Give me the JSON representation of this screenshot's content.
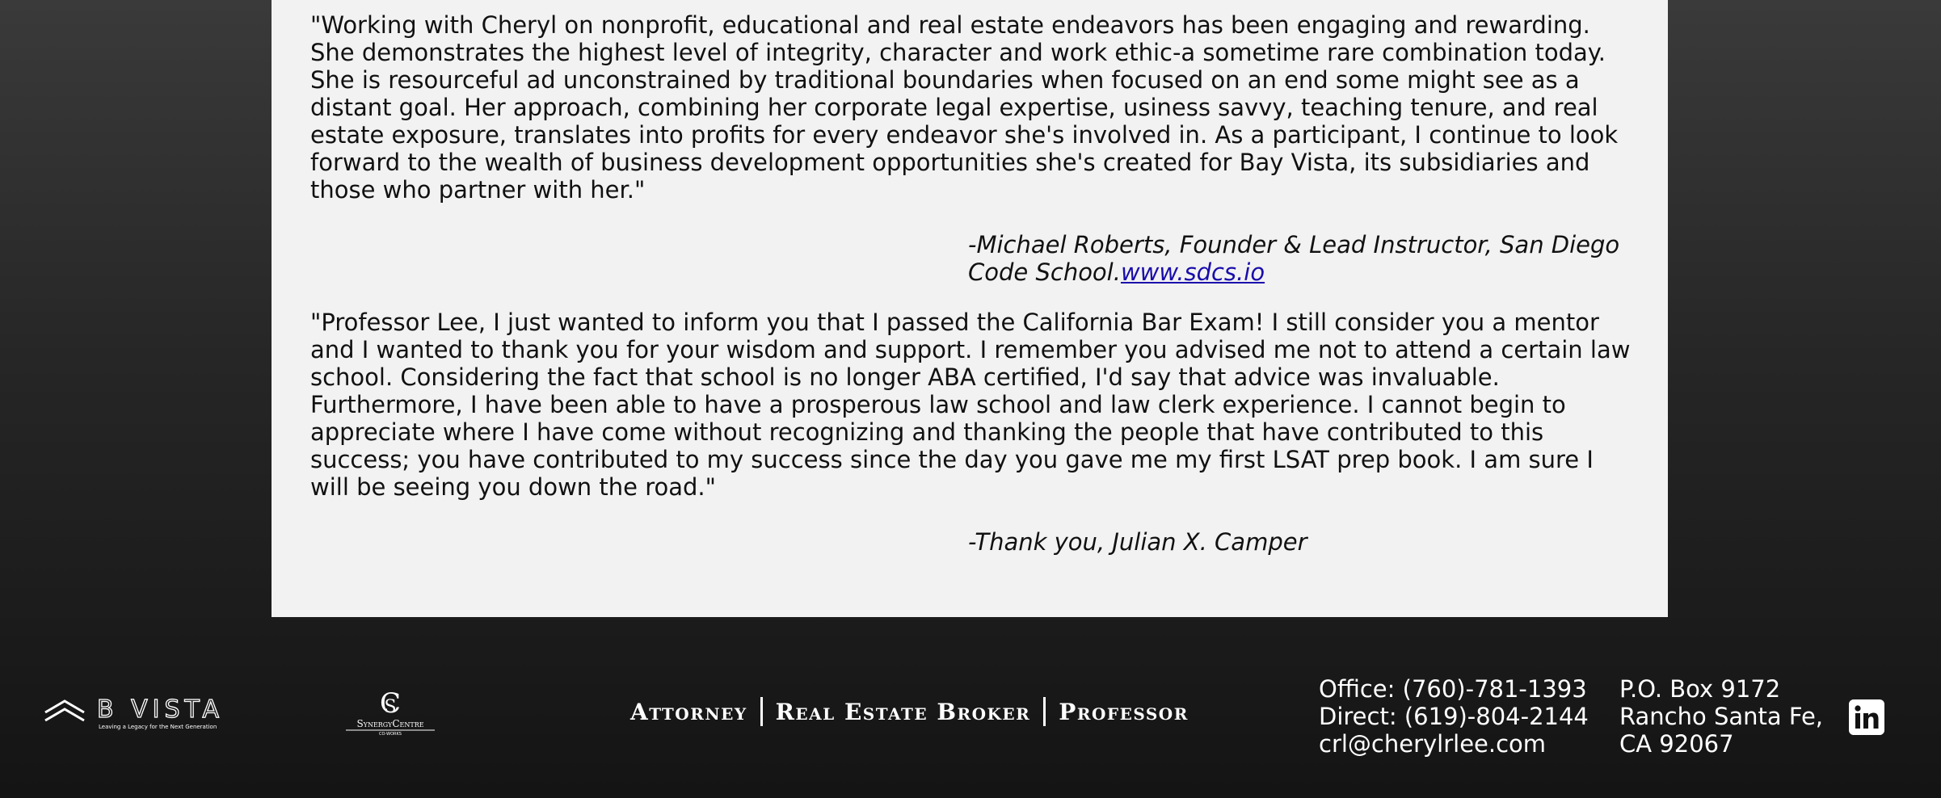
{
  "testimonials": [
    {
      "quote": "\"Working with Cheryl on nonprofit, educational and real estate endeavors has been engaging and rewarding. She demonstrates the highest level of integrity, character and work ethic-a sometime rare combination today. She is resourceful ad unconstrained by traditional boundaries when focused on an end some might see as a distant goal. Her approach, combining her corporate legal expertise, usiness savvy, teaching tenure, and real estate exposure, translates into profits for every endeavor she's involved in. As a participant, I continue to look forward to the wealth of business development opportunities she's created for Bay Vista, its subsidiaries and those who partner with her.\"",
      "attribution": "-Michael Roberts, Founder & Lead Instructor, San Diego Code School.",
      "link_text": "www.sdcs.io"
    },
    {
      "quote": "\"Professor Lee, I just wanted to inform you that I passed the California Bar Exam! I still consider you a mentor and I wanted to thank you for your wisdom and support. I remember you advised me not to attend a certain law school. Considering the fact that school is no longer ABA certified, I'd say that advice was invaluable. Furthermore, I have been able to have a prosperous law school and law clerk experience. I cannot begin to appreciate where I have come without recognizing and thanking the people that have contributed to this success; you have contributed to my success since the day you gave me my first LSAT prep book. I am sure I will be seeing you down the road.\"",
      "attribution": "-Thank you, Julian X. Camper"
    }
  ],
  "footer": {
    "logo_bvista": {
      "text": "B VISTA",
      "subtitle": "Leaving a Legacy for the Next Generation"
    },
    "logo_synergy": {
      "text": "SynergyCentre",
      "subtitle": "CO-WORKS"
    },
    "tagline": [
      "Attorney",
      "Real Estate Broker",
      "Professor"
    ],
    "contact": {
      "office": "Office: (760)-781-1393",
      "direct": "Direct: (619)-804-2144",
      "email": "crl@cherylrlee.com"
    },
    "address": {
      "line1": "P.O. Box 9172",
      "line2": "Rancho Santa Fe,",
      "line3": "CA 92067"
    },
    "social_icon": "linkedin-icon"
  }
}
